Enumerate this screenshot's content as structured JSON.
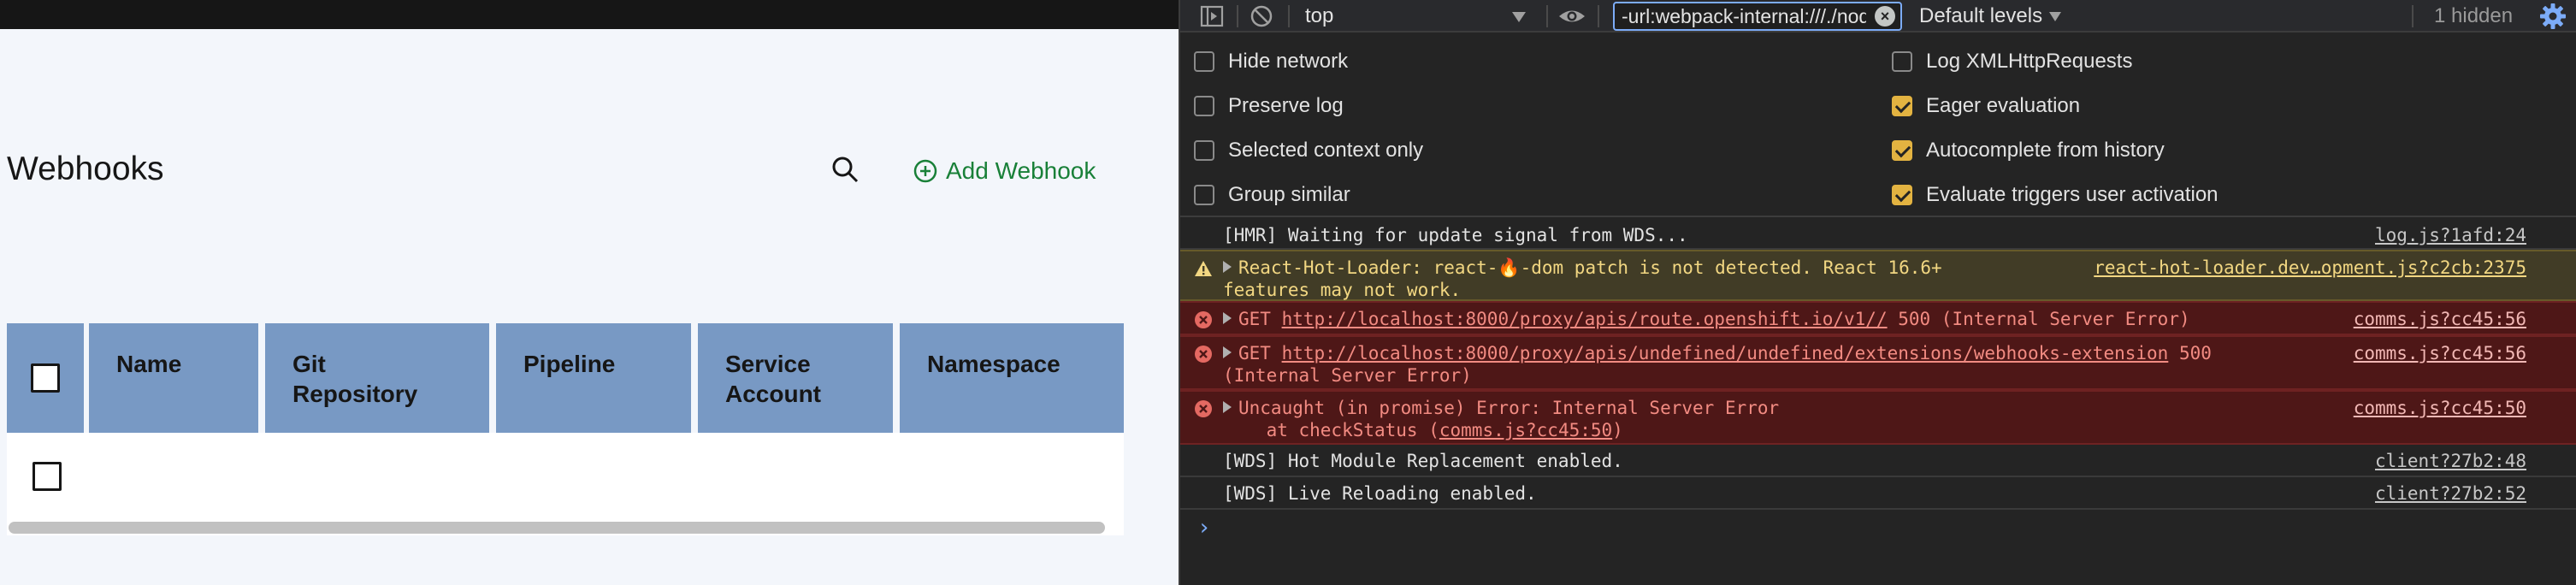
{
  "app": {
    "title": "Webhooks",
    "add_label": "Add Webhook",
    "columns": [
      "Name",
      "Git\nRepository",
      "Pipeline",
      "Service\nAccount",
      "Namespace"
    ],
    "colors": {
      "header_bg": "#7899c4",
      "accent": "#198038",
      "page_bg": "#f3f6fb"
    }
  },
  "devtools": {
    "context": "top",
    "filter_value": "-url:webpack-internal:///./node_modules",
    "levels": "Default levels",
    "hidden": "1 hidden",
    "settings_left": [
      "Hide network",
      "Preserve log",
      "Selected context only",
      "Group similar"
    ],
    "settings_right": [
      "Log XMLHttpRequests",
      "Eager evaluation",
      "Autocomplete from history",
      "Evaluate triggers user activation"
    ],
    "messages": [
      {
        "type": "log",
        "text": "[HMR] Waiting for update signal from WDS...",
        "source": "log.js?1afd:24"
      },
      {
        "type": "warn",
        "text": "React-Hot-Loader: react-🔥-dom patch is not detected. React 16.6+\nfeatures may not work.",
        "source": "react-hot-loader.dev…opment.js?c2cb:2375"
      },
      {
        "type": "error",
        "prefix": "GET ",
        "url": "http://localhost:8000/proxy/apis/route.openshift.io/v1//",
        "suffix": " 500 (Internal Server Error)",
        "source": "comms.js?cc45:56"
      },
      {
        "type": "error",
        "prefix": "GET ",
        "url": "http://localhost:8000/proxy/apis/undefined/undefined/extensions/webhooks-extension",
        "suffix": " 500\n(Internal Server Error)",
        "source": "comms.js?cc45:56"
      },
      {
        "type": "error",
        "text": "Uncaught (in promise) Error: Internal Server Error",
        "sub_prefix": "    at checkStatus (",
        "sub_link": "comms.js?cc45:50",
        "sub_suffix": ")",
        "source": "comms.js?cc45:50"
      },
      {
        "type": "log",
        "text": "[WDS] Hot Module Replacement enabled.",
        "source": "client?27b2:48"
      },
      {
        "type": "log",
        "text": "[WDS] Live Reloading enabled.",
        "source": "client?27b2:52"
      }
    ],
    "prompt": "›"
  }
}
